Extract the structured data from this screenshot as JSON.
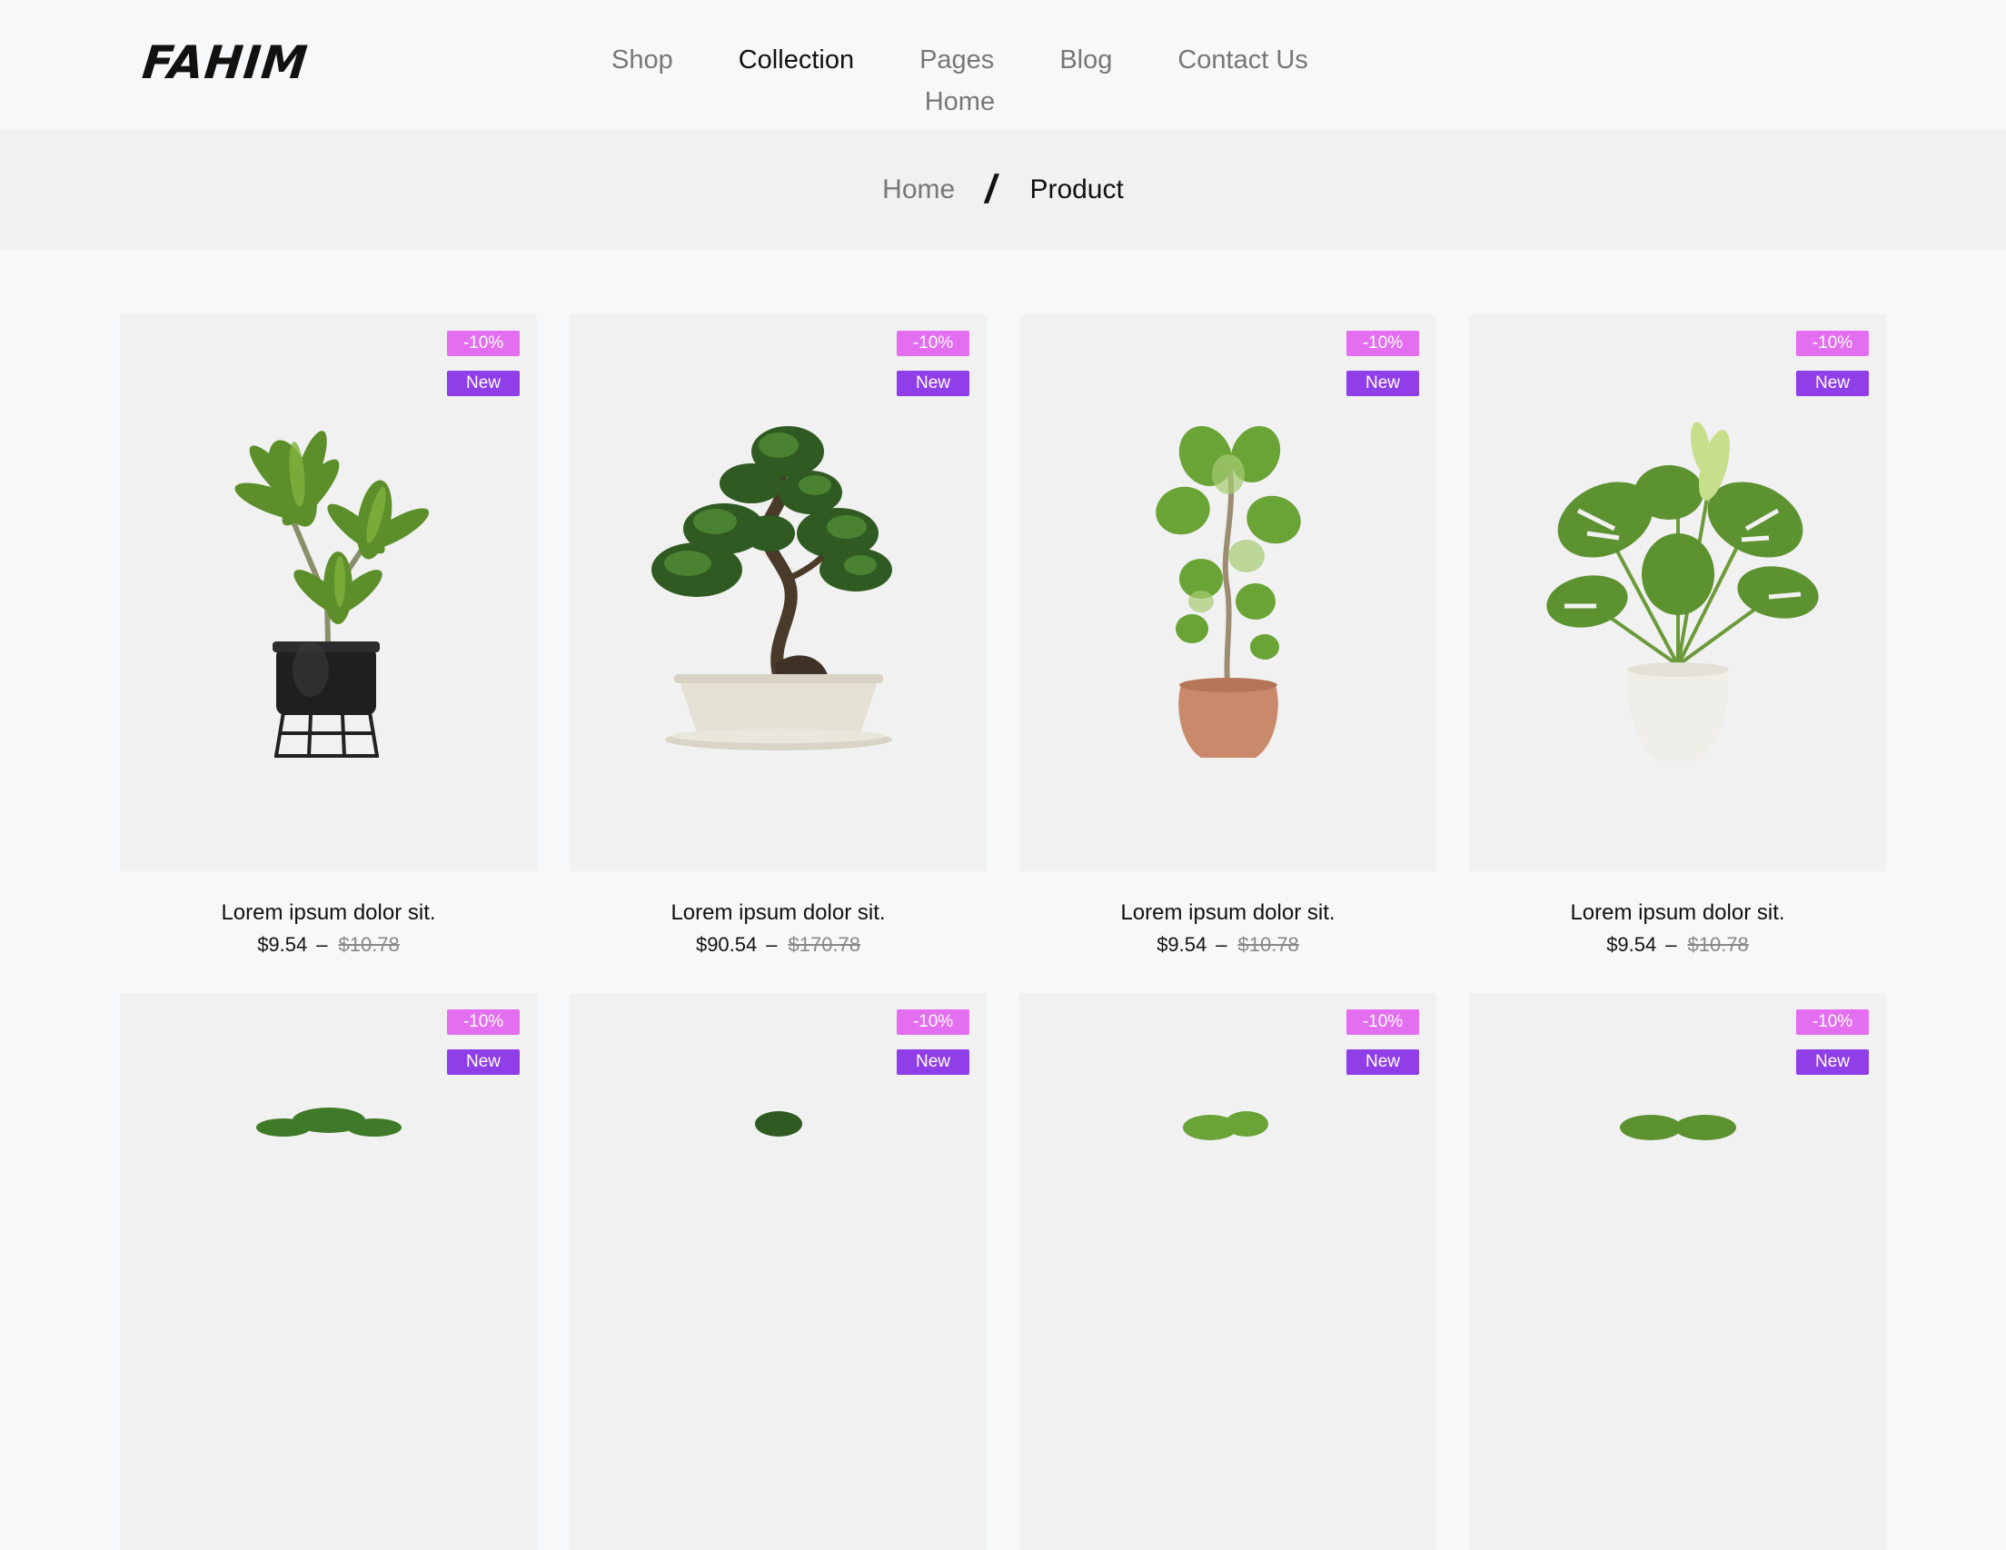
{
  "header": {
    "logo": "FAHIM",
    "nav": [
      "Home",
      "Shop",
      "Collection",
      "Pages",
      "Blog",
      "Contact Us"
    ],
    "active_nav": "Collection"
  },
  "breadcrumb": {
    "home": "Home",
    "separator": "/",
    "current": "Product"
  },
  "products": [
    {
      "title": "Lorem ipsum dolor sit.",
      "price": "$9.54",
      "old_price": "$10.78",
      "discount": "-10%",
      "badge": "New",
      "image": "dracaena-black-pot-icon"
    },
    {
      "title": "Lorem ipsum dolor sit.",
      "price": "$90.54",
      "old_price": "$170.78",
      "discount": "-10%",
      "badge": "New",
      "image": "bonsai-icon"
    },
    {
      "title": "Lorem ipsum dolor sit.",
      "price": "$9.54",
      "old_price": "$10.78",
      "discount": "-10%",
      "badge": "New",
      "image": "fiddle-leaf-fig-icon"
    },
    {
      "title": "Lorem ipsum dolor sit.",
      "price": "$9.54",
      "old_price": "$10.78",
      "discount": "-10%",
      "badge": "New",
      "image": "monstera-white-pot-icon"
    },
    {
      "discount": "-10%",
      "badge": "New",
      "image": "plant-icon"
    },
    {
      "discount": "-10%",
      "badge": "New",
      "image": "plant-icon"
    },
    {
      "discount": "-10%",
      "badge": "New",
      "image": "plant-icon"
    },
    {
      "discount": "-10%",
      "badge": "New",
      "image": "plant-icon"
    }
  ],
  "colors": {
    "discount_badge": "#e36ff0",
    "new_badge": "#8f3ee8",
    "card_bg": "#f1f1f1"
  }
}
